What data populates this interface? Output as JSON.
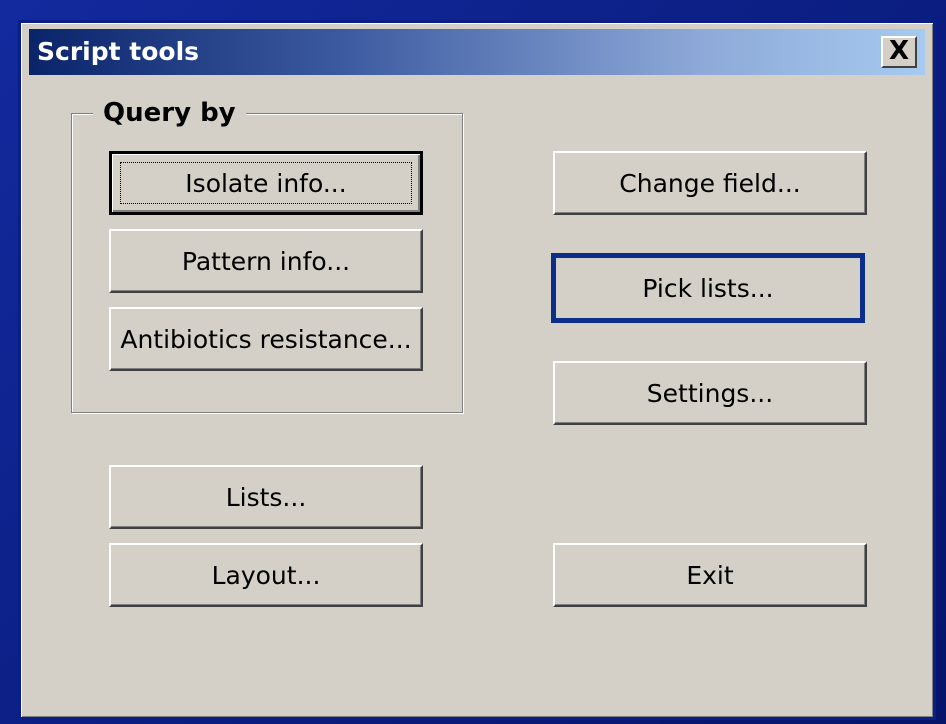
{
  "window": {
    "title": "Script tools",
    "close_label": "X"
  },
  "query_group": {
    "label": "Query by",
    "buttons": [
      "Isolate info...",
      "Pattern info...",
      "Antibiotics resistance..."
    ]
  },
  "left_buttons": {
    "lists": "Lists...",
    "layout": "Layout..."
  },
  "right_buttons": {
    "change_field": "Change field...",
    "pick_lists": "Pick lists...",
    "settings": "Settings...",
    "exit": "Exit"
  },
  "colors": {
    "dialog_bg": "#d4d0c8",
    "title_start": "#0a246a",
    "title_end": "#a6caf0",
    "highlight_border": "#0b2d8c",
    "screen_bg": "#0a1f8c"
  }
}
